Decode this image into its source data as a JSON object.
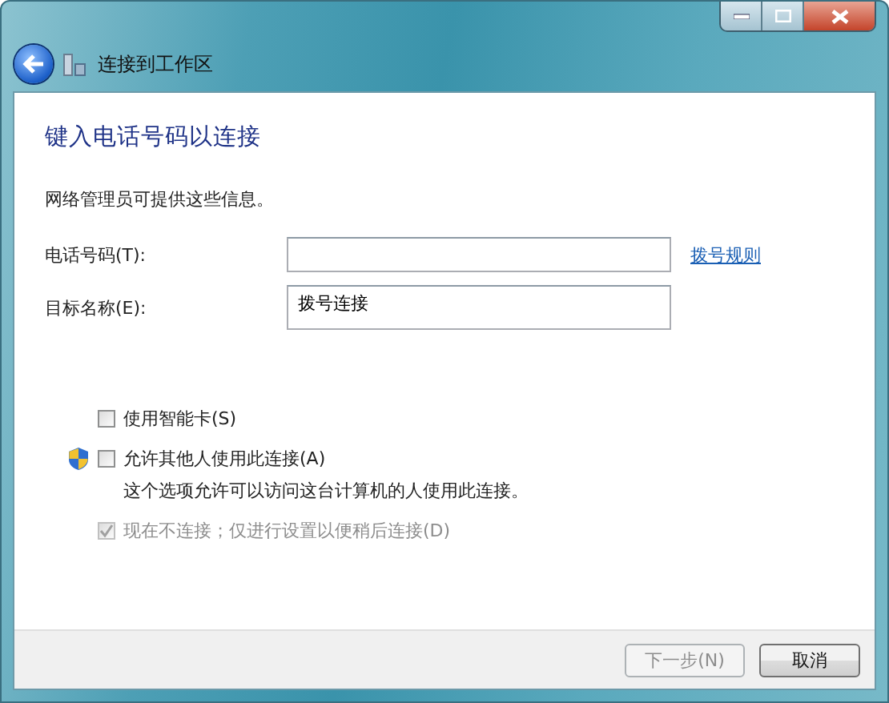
{
  "window": {
    "title": "连接到工作区"
  },
  "heading": "键入电话号码以连接",
  "info": "网络管理员可提供这些信息。",
  "fields": [
    {
      "label": "电话号码(T):",
      "link": "拨号规则"
    },
    {
      "label": "目标名称(E):",
      "value": "拨号连接"
    }
  ],
  "options": [
    {
      "kind": "plain",
      "label": "使用智能卡(S)",
      "checked": false,
      "disabled": false
    },
    {
      "kind": "shield",
      "label": "允许其他人使用此连接(A)",
      "checked": false,
      "disabled": false,
      "note": "这个选项允许可以访问这台计算机的人使用此连接。"
    },
    {
      "kind": "plain",
      "label": "现在不连接；仅进行设置以便稍后连接(D)",
      "checked": true,
      "disabled": true
    }
  ],
  "buttons": [
    {
      "label": "下一步(N)",
      "disabled": true
    },
    {
      "label": "取消",
      "disabled": false
    }
  ]
}
